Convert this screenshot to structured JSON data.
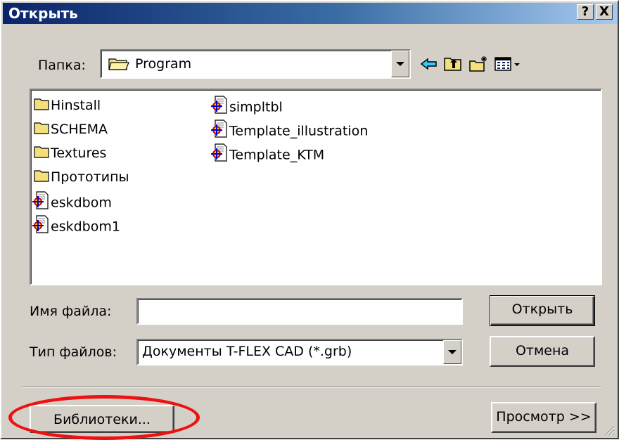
{
  "window": {
    "title": "Открыть",
    "help_label": "?",
    "close_label": "X"
  },
  "folder": {
    "label": "Папка:",
    "value": "Program",
    "toolbar_icons": [
      "back-arrow-icon",
      "up-folder-icon",
      "new-folder-icon",
      "view-menu-icon"
    ]
  },
  "files": {
    "column1": [
      {
        "name": "Hinstall",
        "icon": "folder-icon"
      },
      {
        "name": "SCHEMA",
        "icon": "folder-icon"
      },
      {
        "name": "Textures",
        "icon": "folder-icon"
      },
      {
        "name": "Прототипы",
        "icon": "folder-icon"
      },
      {
        "name": "eskdbom",
        "icon": "tflex-document-icon"
      },
      {
        "name": "eskdbom1",
        "icon": "tflex-document-icon"
      }
    ],
    "column2": [
      {
        "name": "simpltbl",
        "icon": "tflex-document-icon"
      },
      {
        "name": "Template_illustration",
        "icon": "tflex-document-icon"
      },
      {
        "name": "Template_KTM",
        "icon": "tflex-document-icon"
      }
    ]
  },
  "filename": {
    "label": "Имя файла:",
    "value": ""
  },
  "filetype": {
    "label": "Тип файлов:",
    "value": "Документы T-FLEX CAD (*.grb)"
  },
  "buttons": {
    "open": "Открыть",
    "cancel": "Отмена",
    "libraries": "Библиотеки...",
    "preview": "Просмотр >>"
  },
  "colors": {
    "title_bar_start": "#0a246a",
    "title_bar_end": "#a6caf0",
    "dialog_face": "#d4d0c8",
    "highlight": "#ee1111"
  }
}
